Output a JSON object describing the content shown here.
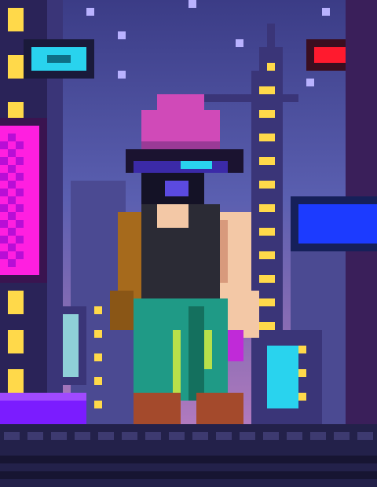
{
  "scene": {
    "palette": {
      "sky_top": "#3b3c86",
      "sky_mid": "#5a5fb0",
      "sky_low": "#8a6db4",
      "sky_horizon": "#b77cc0",
      "building_dark": "#2a2358",
      "building_mid": "#3a3578",
      "building_far": "#4b4a92",
      "window_yellow": "#ffd94a",
      "neon_magenta": "#ff1fe0",
      "neon_cyan": "#29d3ee",
      "neon_red": "#ff1a2e",
      "neon_blue": "#1c3bff",
      "neon_purple": "#7b1cff",
      "street": "#23214a",
      "street_tile": "#3d3a70"
    },
    "signs": [
      {
        "name": "cyan-neon-sign",
        "color": "#29d3ee"
      },
      {
        "name": "red-neon-sign",
        "color": "#ff1a2e"
      },
      {
        "name": "magenta-neon-billboard",
        "color": "#ff1fe0"
      },
      {
        "name": "blue-neon-sign",
        "color": "#1c3bff"
      },
      {
        "name": "cyan-neon-panel",
        "color": "#29d3ee"
      },
      {
        "name": "purple-neon-ledge",
        "color": "#7b1cff"
      }
    ],
    "character": {
      "beanie_color": "#d04ab8",
      "visor_color": "#3b2aa8",
      "skin_color": "#f3c8a6",
      "tank_top_color": "#2b2b35",
      "backpack_color": "#a66a1c",
      "pants_color": "#1f9a86",
      "pants_stripe_color": "#b8e04a",
      "boots_color": "#a44a2c"
    }
  }
}
